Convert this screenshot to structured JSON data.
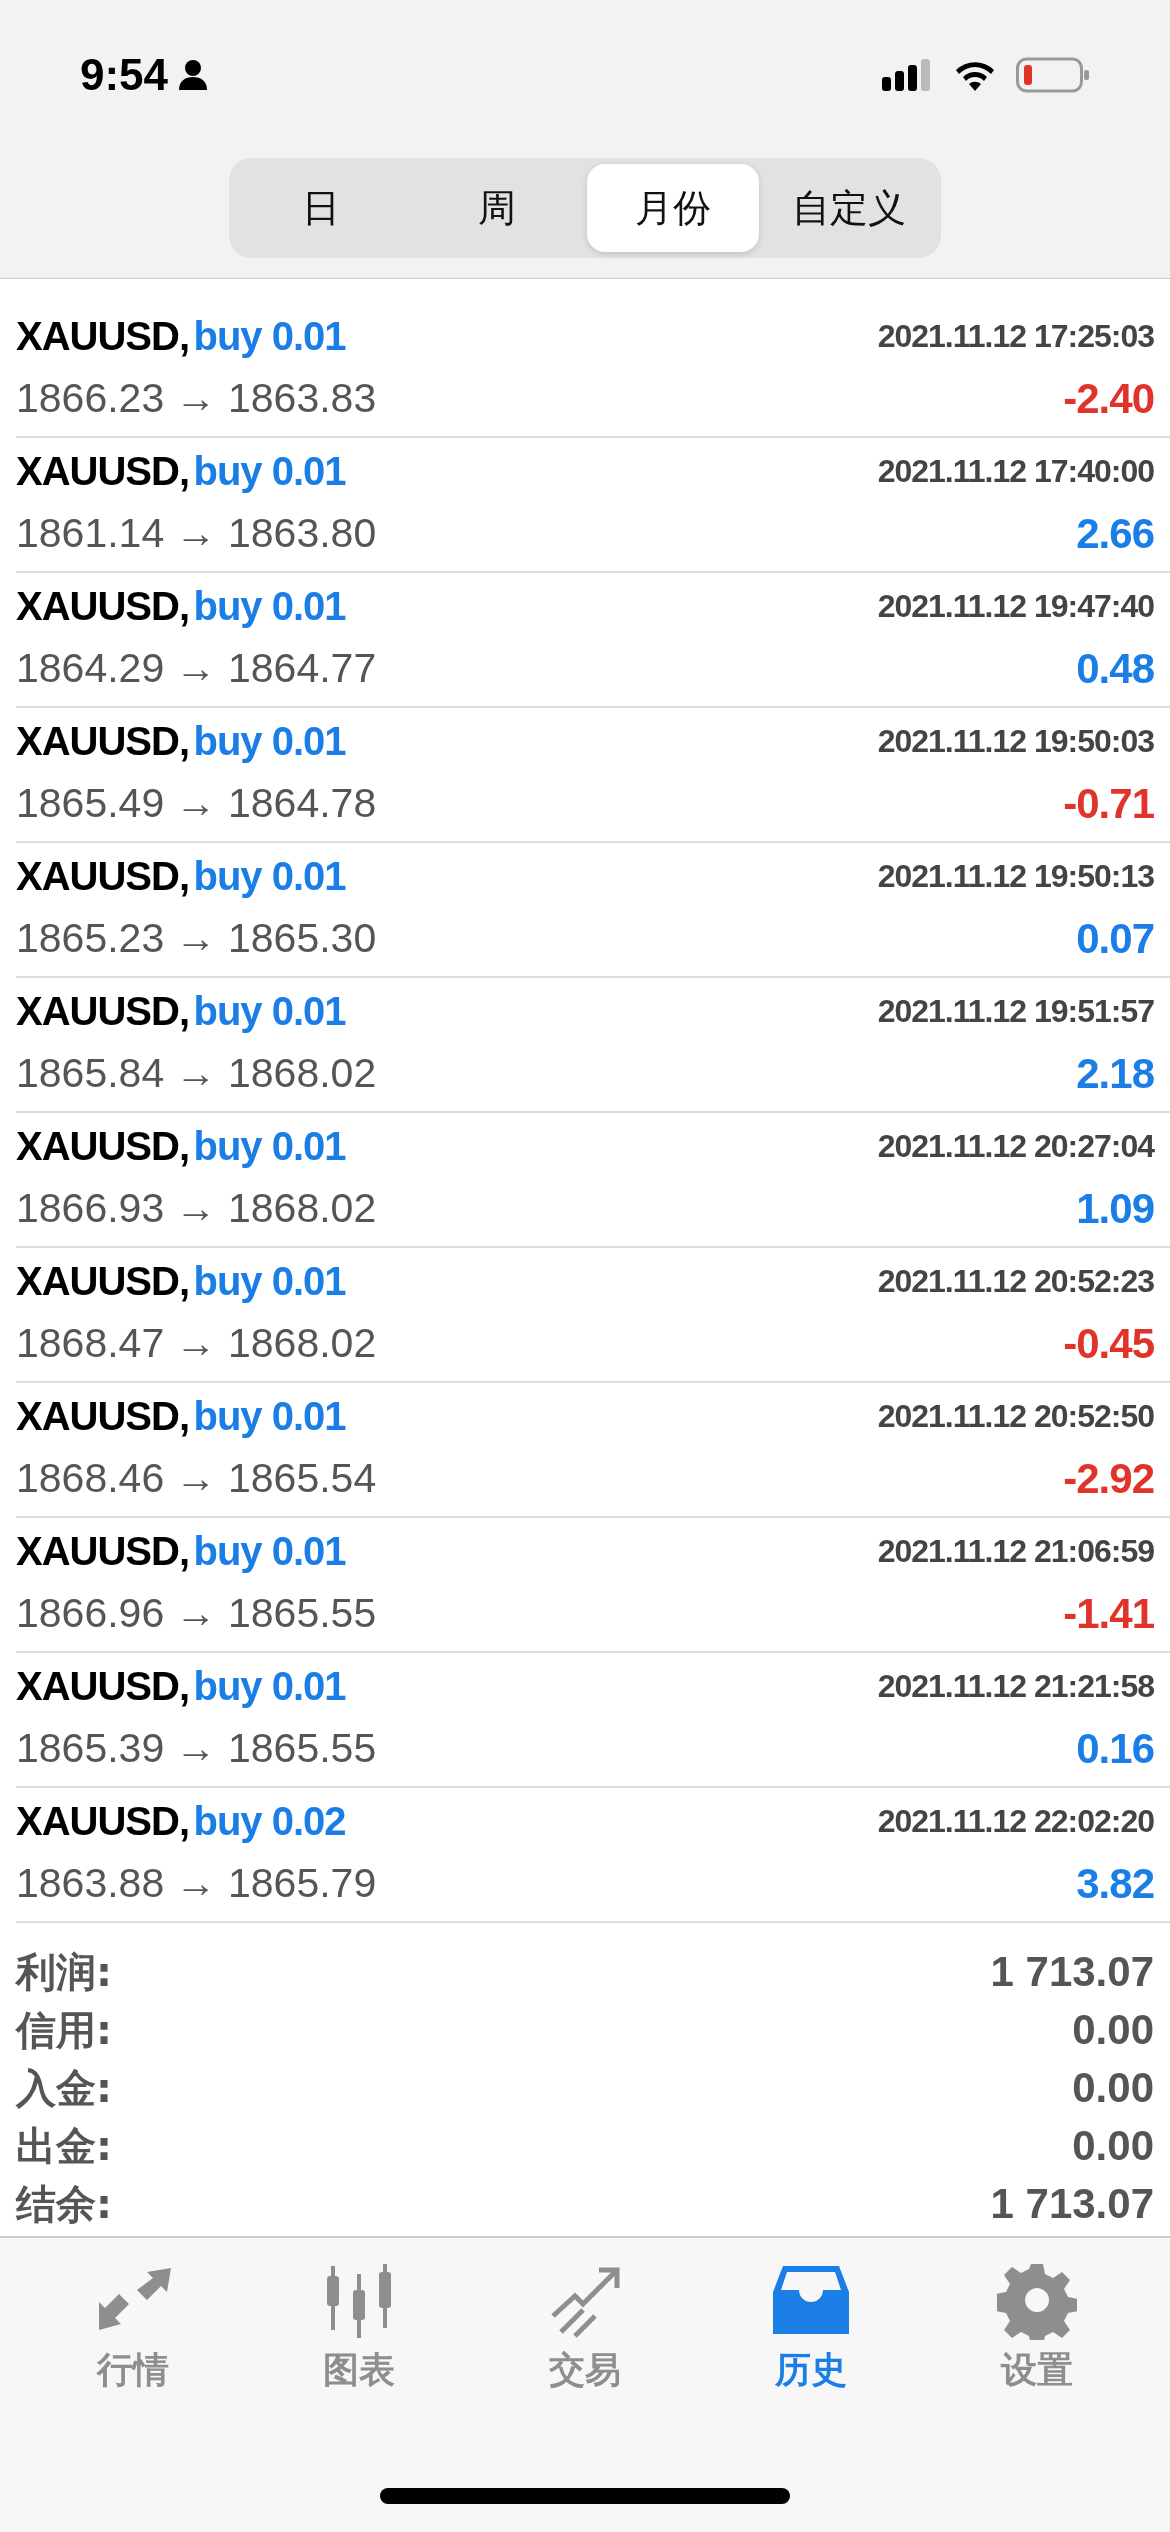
{
  "status_bar": {
    "time": "9:54"
  },
  "period_tabs": [
    {
      "label": "日",
      "selected": false
    },
    {
      "label": "周",
      "selected": false
    },
    {
      "label": "月份",
      "selected": true
    },
    {
      "label": "自定义",
      "selected": false
    }
  ],
  "deals": [
    {
      "symbol": "XAUUSD,",
      "side": "buy",
      "volume": "0.01",
      "time": "2021.11.12 17:25:03",
      "prices": "1866.23 → 1863.83",
      "profit": "-2.40",
      "kind": "loss"
    },
    {
      "symbol": "XAUUSD,",
      "side": "buy",
      "volume": "0.01",
      "time": "2021.11.12 17:40:00",
      "prices": "1861.14 → 1863.80",
      "profit": "2.66",
      "kind": "gain"
    },
    {
      "symbol": "XAUUSD,",
      "side": "buy",
      "volume": "0.01",
      "time": "2021.11.12 19:47:40",
      "prices": "1864.29 → 1864.77",
      "profit": "0.48",
      "kind": "gain"
    },
    {
      "symbol": "XAUUSD,",
      "side": "buy",
      "volume": "0.01",
      "time": "2021.11.12 19:50:03",
      "prices": "1865.49 → 1864.78",
      "profit": "-0.71",
      "kind": "loss"
    },
    {
      "symbol": "XAUUSD,",
      "side": "buy",
      "volume": "0.01",
      "time": "2021.11.12 19:50:13",
      "prices": "1865.23 → 1865.30",
      "profit": "0.07",
      "kind": "gain"
    },
    {
      "symbol": "XAUUSD,",
      "side": "buy",
      "volume": "0.01",
      "time": "2021.11.12 19:51:57",
      "prices": "1865.84 → 1868.02",
      "profit": "2.18",
      "kind": "gain"
    },
    {
      "symbol": "XAUUSD,",
      "side": "buy",
      "volume": "0.01",
      "time": "2021.11.12 20:27:04",
      "prices": "1866.93 → 1868.02",
      "profit": "1.09",
      "kind": "gain"
    },
    {
      "symbol": "XAUUSD,",
      "side": "buy",
      "volume": "0.01",
      "time": "2021.11.12 20:52:23",
      "prices": "1868.47 → 1868.02",
      "profit": "-0.45",
      "kind": "loss"
    },
    {
      "symbol": "XAUUSD,",
      "side": "buy",
      "volume": "0.01",
      "time": "2021.11.12 20:52:50",
      "prices": "1868.46 → 1865.54",
      "profit": "-2.92",
      "kind": "loss"
    },
    {
      "symbol": "XAUUSD,",
      "side": "buy",
      "volume": "0.01",
      "time": "2021.11.12 21:06:59",
      "prices": "1866.96 → 1865.55",
      "profit": "-1.41",
      "kind": "loss"
    },
    {
      "symbol": "XAUUSD,",
      "side": "buy",
      "volume": "0.01",
      "time": "2021.11.12 21:21:58",
      "prices": "1865.39 → 1865.55",
      "profit": "0.16",
      "kind": "gain"
    },
    {
      "symbol": "XAUUSD,",
      "side": "buy",
      "volume": "0.02",
      "time": "2021.11.12 22:02:20",
      "prices": "1863.88 → 1865.79",
      "profit": "3.82",
      "kind": "gain"
    }
  ],
  "summary": [
    {
      "label": "利润:",
      "value": "1 713.07"
    },
    {
      "label": "信用:",
      "value": "0.00"
    },
    {
      "label": "入金:",
      "value": "0.00"
    },
    {
      "label": "出金:",
      "value": "0.00"
    },
    {
      "label": "结余:",
      "value": "1 713.07"
    }
  ],
  "tab_bar": [
    {
      "label": "行情",
      "kind": "quotes",
      "selected": false
    },
    {
      "label": "图表",
      "kind": "chart",
      "selected": false
    },
    {
      "label": "交易",
      "kind": "trade",
      "selected": false
    },
    {
      "label": "历史",
      "kind": "history",
      "selected": true
    },
    {
      "label": "设置",
      "kind": "settings",
      "selected": false
    }
  ]
}
